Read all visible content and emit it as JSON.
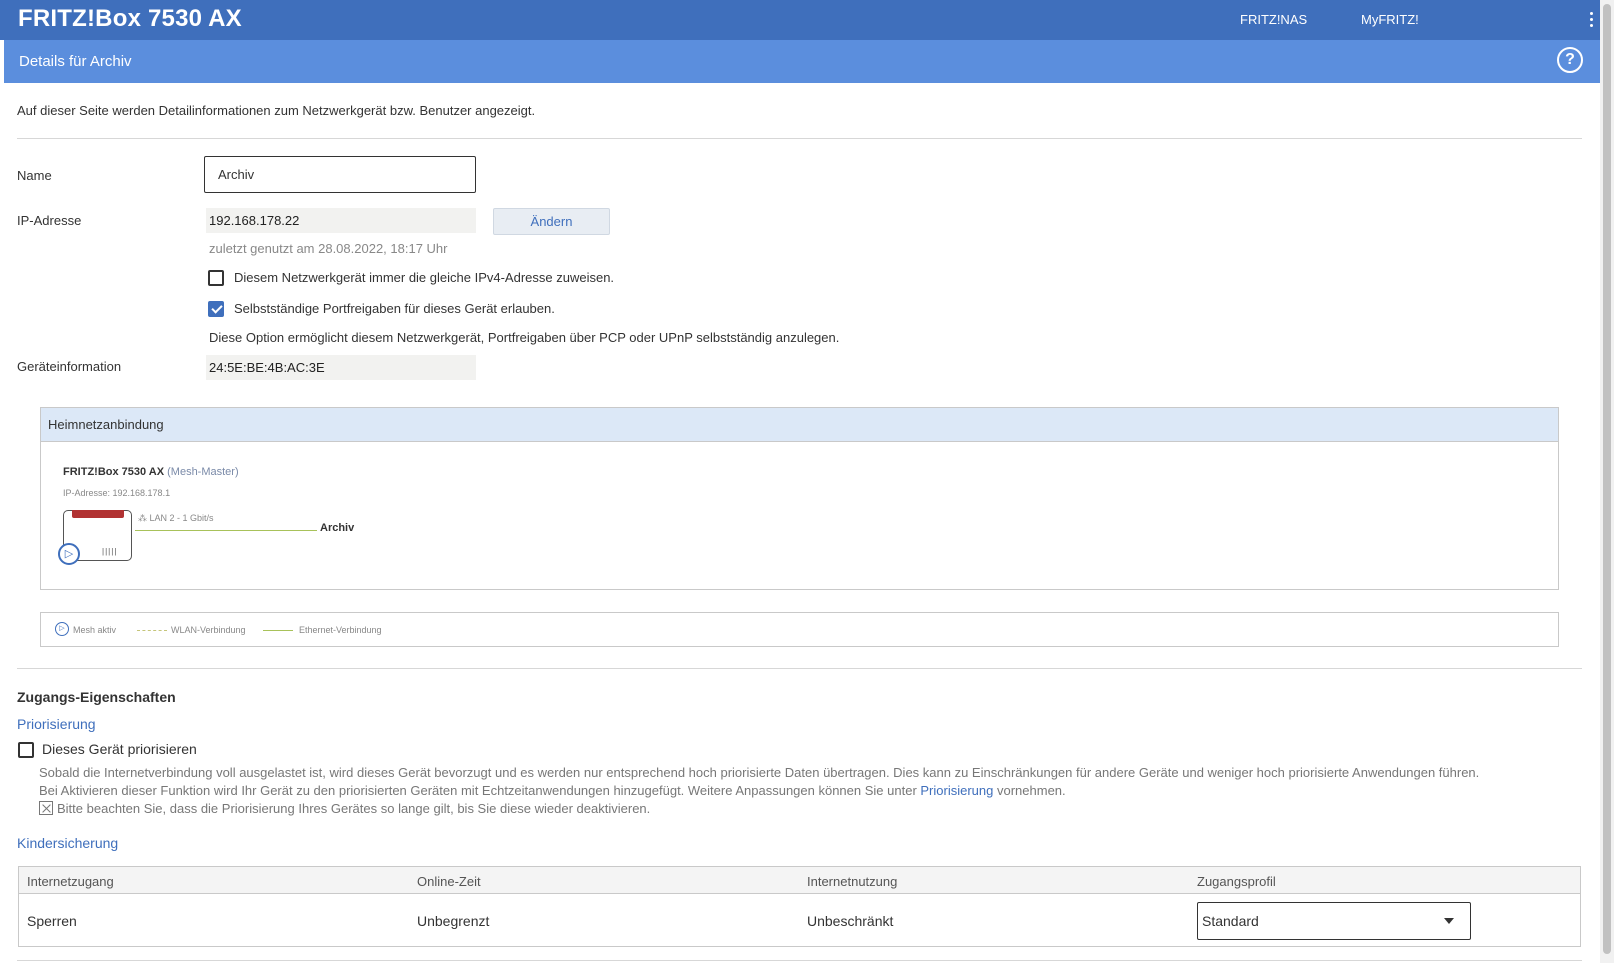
{
  "app": {
    "brand": "FRITZ!Box 7530 AX",
    "nav": [
      "FRITZ!NAS",
      "MyFRITZ!"
    ]
  },
  "page": {
    "title": "Details für Archiv",
    "intro": "Auf dieser Seite werden Detailinformationen zum Netzwerkgerät bzw. Benutzer angezeigt."
  },
  "form": {
    "name_label": "Name",
    "name_value": "Archiv",
    "ip_label": "IP-Adresse",
    "ip_value": "192.168.178.22",
    "change_button": "Ändern",
    "last_used": "zuletzt genutzt am 28.08.2022, 18:17 Uhr",
    "same_ip_label": "Diesem Netzwerkgerät immer die gleiche IPv4-Adresse zuweisen.",
    "same_ip_checked": false,
    "portfwd_label": "Selbstständige Portfreigaben für dieses Gerät erlauben.",
    "portfwd_checked": true,
    "portfwd_note": "Diese Option ermöglicht diesem Netzwerkgerät, Portfreigaben über PCP oder UPnP selbstständig anzulegen.",
    "device_info_label": "Geräteinformation",
    "device_info_value": "24:5E:BE:4B:AC:3E"
  },
  "mesh": {
    "heading": "Heimnetzanbindung",
    "device_name": "FRITZ!Box 7530 AX",
    "device_role": "(Mesh-Master)",
    "device_ip": "IP-Adresse: 192.168.178.1",
    "link_label": "LAN 2 - 1 Gbit/s",
    "client_name": "Archiv",
    "legend": {
      "mesh_active": "Mesh aktiv",
      "wlan": "WLAN-Verbindung",
      "ethernet": "Ethernet-Verbindung"
    }
  },
  "access": {
    "heading": "Zugangs-Eigenschaften",
    "prio_heading": "Priorisierung",
    "prio_checkbox": "Dieses Gerät priorisieren",
    "prio_checked": false,
    "prio_desc_1": "Sobald die Internetverbindung voll ausgelastet ist, wird dieses Gerät bevorzugt und es werden nur entsprechend hoch priorisierte Daten übertragen. Dies kann zu Einschränkungen für andere Geräte und weniger hoch priorisierte Anwendungen führen.",
    "prio_desc_2a": "Bei Aktivieren dieser Funktion wird Ihr Gerät zu den priorisierten Geräten mit Echtzeitanwendungen hinzugefügt. Weitere Anpassungen können Sie unter ",
    "prio_desc_2_link": "Priorisierung",
    "prio_desc_2b": " vornehmen.",
    "prio_desc_3": "Bitte beachten Sie, dass die Priorisierung Ihres Gerätes so lange gilt, bis Sie diese wieder deaktivieren.",
    "parental_heading": "Kindersicherung",
    "table": {
      "headers": [
        "Internetzugang",
        "Online-Zeit",
        "Internetnutzung",
        "Zugangsprofil"
      ],
      "row": {
        "access": "Sperren",
        "online_time": "Unbegrenzt",
        "usage": "Unbeschränkt",
        "profile": "Standard"
      }
    }
  }
}
